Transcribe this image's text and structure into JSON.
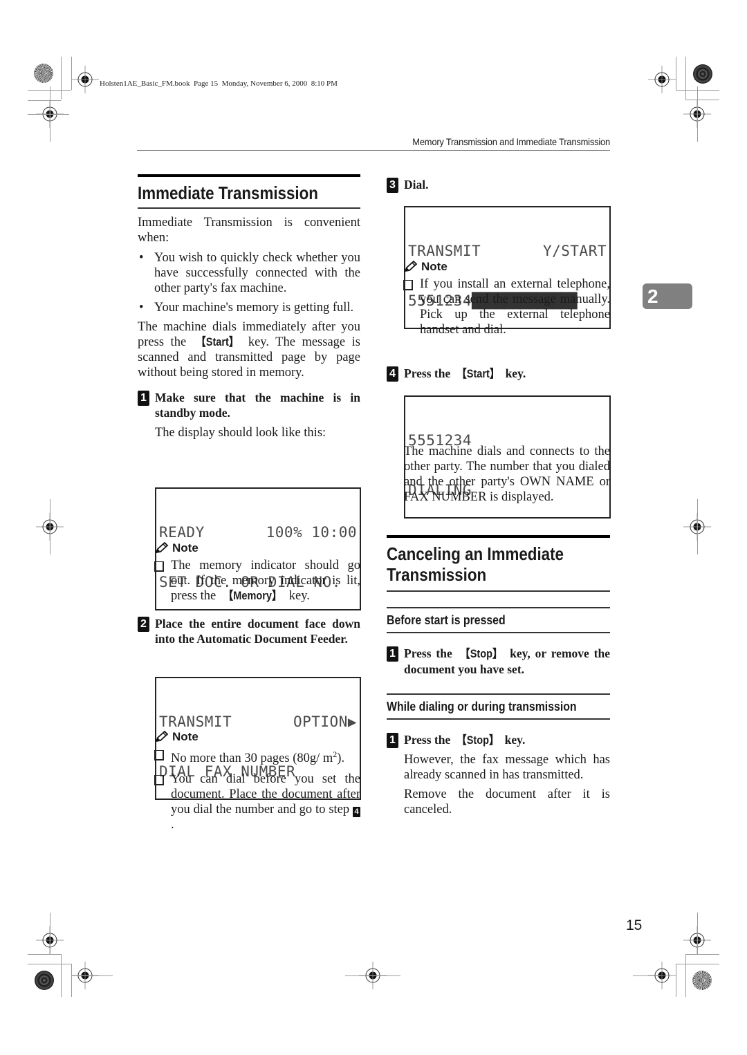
{
  "file_info": "Holsten1AE_Basic_FM.book  Page 15  Monday, November 6, 2000  8:10 PM",
  "running_header": "Memory Transmission and Immediate Transmission",
  "chapter_tab": "2",
  "page_number": "15",
  "icons": {
    "registration_mark": "crosshair-circle",
    "color_disc": "sunburst-disc",
    "note": "pencil-icon",
    "note_item": "checkbox-icon",
    "bullet": "bullet-dot"
  },
  "left": {
    "title": "Immediate Transmission",
    "intro": "Immediate Transmission is convenient when:",
    "bullets": [
      "You wish to quickly check whether you have successfully connected with the other party's fax machine.",
      "Your machine's memory is getting full."
    ],
    "para_before": "The machine dials immediately after you press the ",
    "para_key": "【Start】",
    "para_after": " key. The message is scanned and transmitted page by page without being stored in memory.",
    "step1": {
      "num": "1",
      "text": "Make sure that the machine is in standby mode.",
      "sub": "The display should look like this:",
      "lcd": {
        "line1_left": "READY",
        "line1_right": "100% 10:00",
        "line2": "SET DOC. OR DIAL NO."
      },
      "note_label": "Note",
      "note_before": "The memory indicator should go out. If the memory indicator is lit, press the ",
      "note_key": "【Memory】",
      "note_after": " key."
    },
    "step2": {
      "num": "2",
      "text": "Place the entire document face down into the Automatic Document Feeder.",
      "lcd": {
        "line1_left": "TRANSMIT",
        "line1_right": "OPTION▶",
        "line2": "DIAL FAX NUMBER"
      },
      "note_label": "Note",
      "note1_before": "No more than 30 pages (80g/ m",
      "note1_sup": "2",
      "note1_after": ").",
      "note2_before": "You can dial before you set the document. Place the document after you dial the number and go to step ",
      "note2_step": "4",
      "note2_after": "."
    }
  },
  "right": {
    "step3": {
      "num": "3",
      "text": "Dial.",
      "lcd": {
        "line1_left": "TRANSMIT",
        "line1_right": "Y/START",
        "line2_number": "5551234",
        "line2_fill": "█████████████"
      },
      "note_label": "Note",
      "note_text": "If you install an external telephone, you can send the message manually. Pick up the external telephone handset and dial."
    },
    "step4": {
      "num": "4",
      "text_before": "Press the ",
      "key": "【Start】",
      "text_after": " key.",
      "lcd": {
        "line1": "5551234",
        "line2": "DIALING"
      },
      "para": "The machine dials and connects to the other party. The number that you dialed and the other party's OWN NAME or FAX NUMBER is displayed."
    },
    "cancel": {
      "title": "Canceling an Immediate Transmission",
      "sub1": {
        "title": "Before start is pressed",
        "num": "1",
        "text_before": "Press the ",
        "key": "【Stop】",
        "text_after": " key, or remove the document you have set."
      },
      "sub2": {
        "title": "While dialing or during transmission",
        "num": "1",
        "text_before": "Press the ",
        "key": "【Stop】",
        "text_after": " key.",
        "para1": "However, the fax message which has already scanned in has transmitted.",
        "para2": "Remove the document after it is canceled."
      }
    }
  }
}
